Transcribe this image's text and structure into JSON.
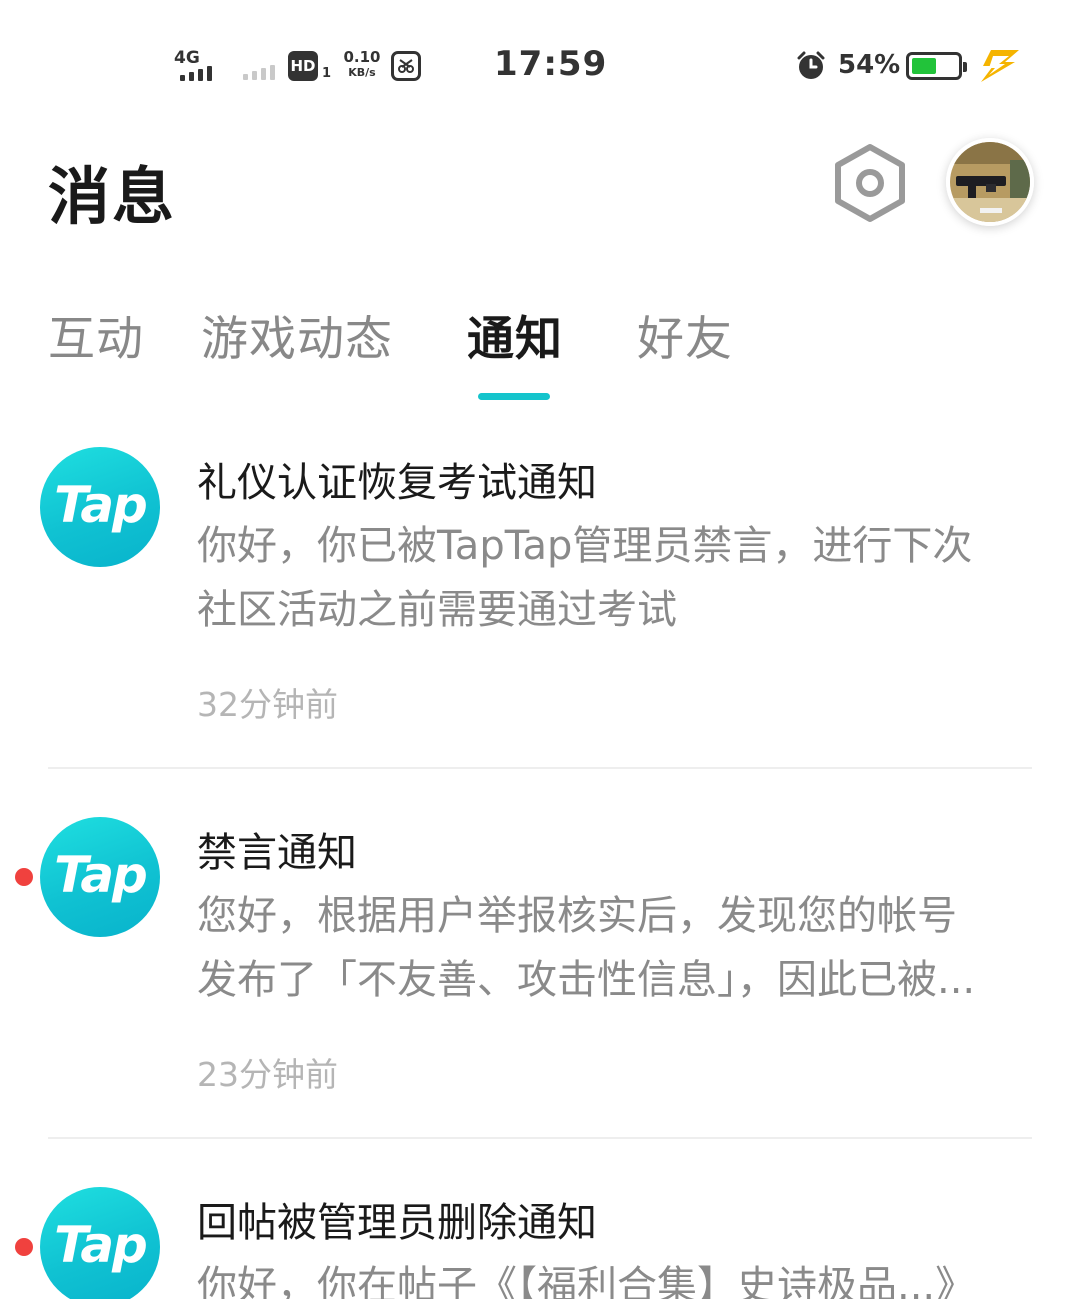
{
  "status_bar": {
    "network": "4G",
    "hd_label": "HD",
    "hd_sub": "1",
    "speed_value": "0.10",
    "speed_unit": "KB/s",
    "time": "17:59",
    "battery_pct": "54%",
    "battery_level": 0.54,
    "icons": [
      "signal-icon",
      "hd-icon",
      "screenshot-app-icon",
      "alarm-icon",
      "battery-icon",
      "charging-icon"
    ]
  },
  "header": {
    "title": "消息",
    "settings_icon": "hexagon-settings-icon",
    "avatar": "user-avatar"
  },
  "tabs": [
    {
      "label": "互动",
      "active": false
    },
    {
      "label": "游戏动态",
      "active": false
    },
    {
      "label": "通知",
      "active": true
    },
    {
      "label": "好友",
      "active": false
    }
  ],
  "notifications": [
    {
      "logo_text": "Tap",
      "title": "礼仪认证恢复考试通知",
      "body_line1": "你好，你已被TapTap管理员禁言，进行下次",
      "body_line2": "社区活动之前需要通过考试",
      "time": "32分钟前",
      "unread": false
    },
    {
      "logo_text": "Tap",
      "title": "禁言通知",
      "body_line1": "您好，根据用户举报核实后，发现您的帐号",
      "body_line2": "发布了「不友善、攻击性信息」，因此已被...",
      "time": "23分钟前",
      "unread": true
    },
    {
      "logo_text": "Tap",
      "title": "回帖被管理员删除通知",
      "body_line1": "你好，你在帖子《【福利合集】史诗极品...》",
      "unread": true
    }
  ],
  "colors": {
    "accent": "#14c4cc",
    "unread_dot": "#f0413e",
    "battery_fill": "#22c33a",
    "charge_bolt": "#f5b400"
  }
}
